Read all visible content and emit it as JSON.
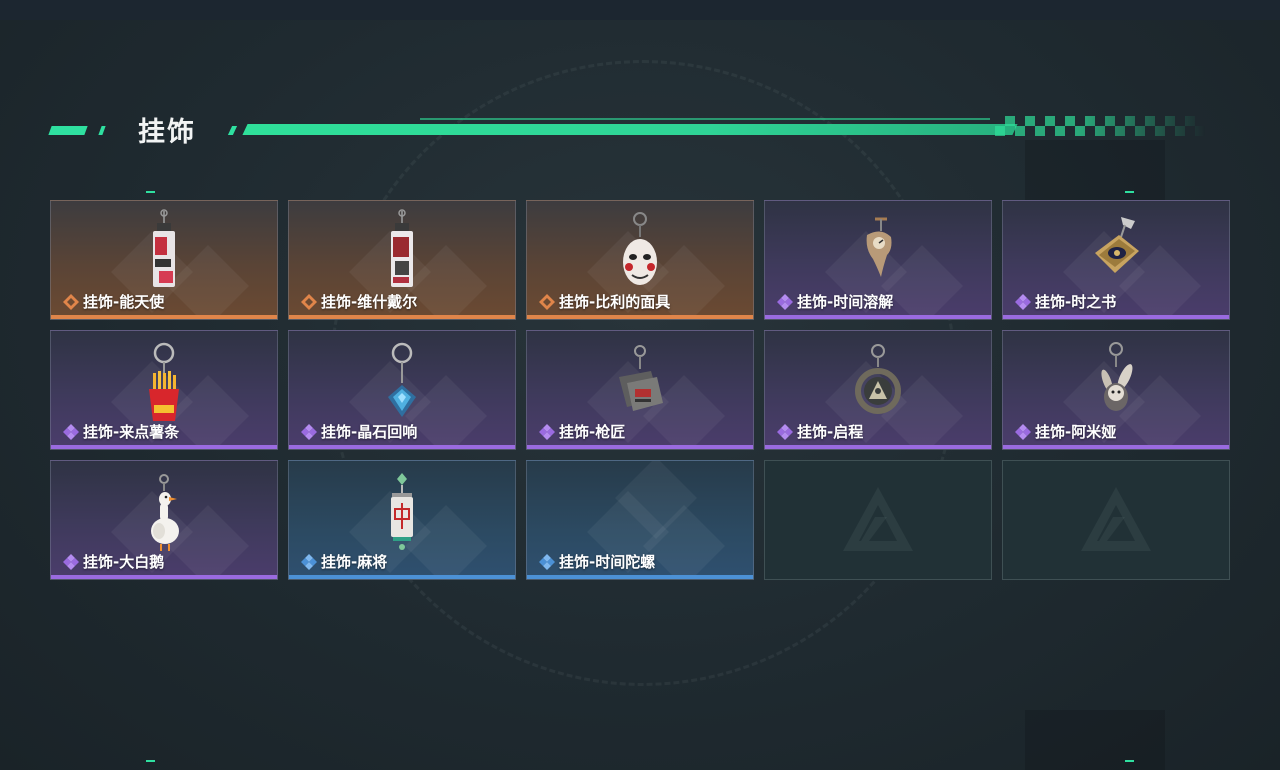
{
  "header": {
    "title": "挂饰"
  },
  "colors": {
    "accent": "#2fe0a0",
    "rarity_orange": "#e0854a",
    "rarity_purple": "#9a6be0",
    "rarity_blue": "#4c91d6"
  },
  "items": [
    {
      "label": "挂饰-能天使",
      "rarity": "orange",
      "icon": "tag-keychain-icon"
    },
    {
      "label": "挂饰-维什戴尔",
      "rarity": "orange",
      "icon": "tag-keychain-icon"
    },
    {
      "label": "挂饰-比利的面具",
      "rarity": "orange",
      "icon": "mask-keychain-icon"
    },
    {
      "label": "挂饰-时间溶解",
      "rarity": "purple",
      "icon": "melting-clock-icon"
    },
    {
      "label": "挂饰-时之书",
      "rarity": "purple",
      "icon": "book-of-time-icon"
    },
    {
      "label": "挂饰-来点薯条",
      "rarity": "purple",
      "icon": "fries-keychain-icon"
    },
    {
      "label": "挂饰-晶石回响",
      "rarity": "purple",
      "icon": "crystal-keychain-icon"
    },
    {
      "label": "挂饰-枪匠",
      "rarity": "purple",
      "icon": "gunsmith-keychain-icon"
    },
    {
      "label": "挂饰-启程",
      "rarity": "purple",
      "icon": "ring-emblem-icon"
    },
    {
      "label": "挂饰-阿米娅",
      "rarity": "purple",
      "icon": "rabbit-keychain-icon"
    },
    {
      "label": "挂饰-大白鹅",
      "rarity": "purple",
      "icon": "goose-keychain-icon"
    },
    {
      "label": "挂饰-麻将",
      "rarity": "blue",
      "icon": "mahjong-tile-icon"
    },
    {
      "label": "挂饰-时间陀螺",
      "rarity": "blue",
      "icon": ""
    }
  ],
  "empty_slots": [
    {
      "icon": "placeholder-logo-icon"
    },
    {
      "icon": "placeholder-logo-icon"
    }
  ]
}
